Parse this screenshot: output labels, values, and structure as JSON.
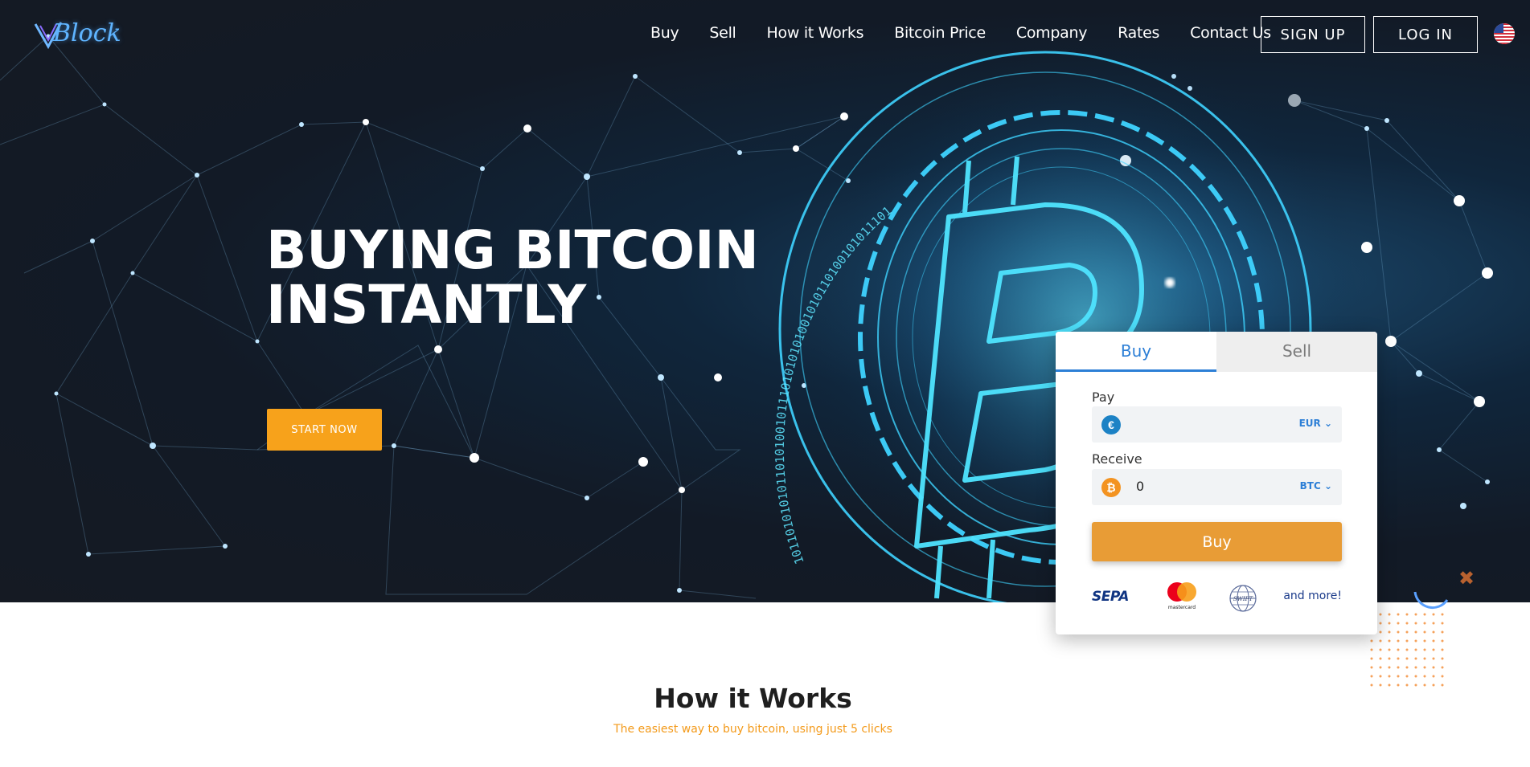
{
  "brand": {
    "logo_text": "Block"
  },
  "nav": {
    "links": [
      "Buy",
      "Sell",
      "How it Works",
      "Bitcoin Price",
      "Company",
      "Rates",
      "Contact Us"
    ],
    "signup_label": "SIGN UP",
    "login_label": "LOG IN",
    "language_icon": "us-flag-icon"
  },
  "hero": {
    "title_line1": "BUYING BITCOIN",
    "title_line2": "INSTANTLY",
    "cta_label": "START NOW",
    "binary_text": "10110101010110101001011101010101001010110100101011101"
  },
  "exchange_widget": {
    "tabs": [
      {
        "label": "Buy",
        "active": true
      },
      {
        "label": "Sell",
        "active": false
      }
    ],
    "pay": {
      "label": "Pay",
      "value": "",
      "currency": "EUR",
      "coin_icon": "euro-coin-icon"
    },
    "receive": {
      "label": "Receive",
      "value": "0",
      "currency": "BTC",
      "coin_icon": "bitcoin-coin-icon"
    },
    "submit_label": "Buy",
    "payment_methods": {
      "sepa": "SEPA",
      "mastercard": "mastercard",
      "swift": "SWIFT",
      "more": "and more!"
    }
  },
  "how_it_works": {
    "title": "How it Works",
    "subtitle": "The easiest way to buy bitcoin, using just 5 clicks"
  },
  "colors": {
    "accent_orange": "#f7a21b",
    "buy_button": "#e89c36",
    "tab_active": "#2d7fd6",
    "hero_dark": "#151a23",
    "glow_cyan": "#3fd3ff"
  }
}
